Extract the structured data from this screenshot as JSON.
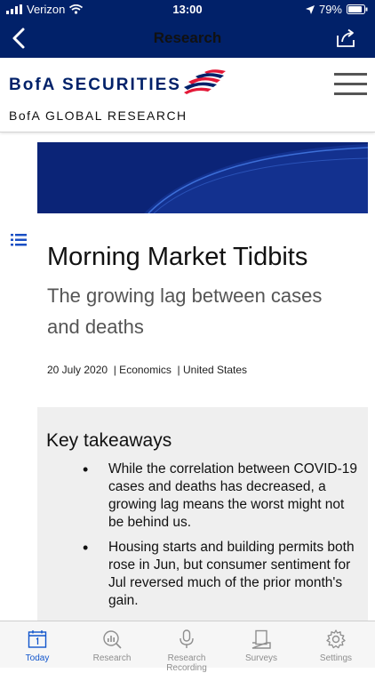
{
  "status_bar": {
    "carrier": "Verizon",
    "time": "13:00",
    "battery": "79%"
  },
  "nav": {
    "title": "Research"
  },
  "brand": {
    "name": "BofA SECURITIES",
    "sub": "BofA GLOBAL RESEARCH"
  },
  "article": {
    "title": "Morning Market Tidbits",
    "subtitle": "The growing lag between cases and deaths",
    "date": "20 July 2020",
    "category": "| Economics",
    "region": "| United States"
  },
  "takeaways": {
    "heading": "Key takeaways",
    "items": [
      "While the correlation between COVID-19 cases and deaths has decreased, a growing lag means the worst might not be behind us.",
      "Housing starts and building permits both rose in Jun, but consumer sentiment for Jul reversed much of the prior month's gain."
    ]
  },
  "tabs": [
    {
      "label": "Today",
      "icon": "calendar-icon",
      "active": true
    },
    {
      "label": "Research",
      "icon": "research-search-icon",
      "active": false
    },
    {
      "label": "Research Recording",
      "icon": "microphone-icon",
      "active": false
    },
    {
      "label": "Surveys",
      "icon": "survey-icon",
      "active": false
    },
    {
      "label": "Settings",
      "icon": "gear-icon",
      "active": false
    }
  ],
  "colors": {
    "brand_navy": "#012169",
    "brand_red": "#e31837",
    "active_tab": "#1155cc"
  }
}
